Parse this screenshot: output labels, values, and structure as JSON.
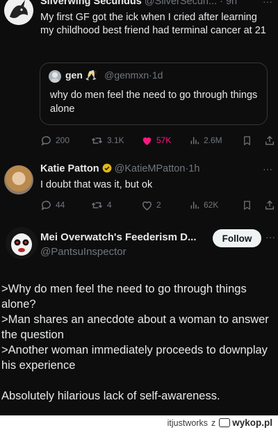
{
  "tweet1": {
    "display_name": "Silverwing Secundus",
    "handle": "@SilverSecun...",
    "time": "9h",
    "text": "My first GF got the ick when I cried after learning my childhood best friend had terminal cancer at 21",
    "quote": {
      "name": "gen",
      "emoji": "🥂",
      "handle": "@genmxn",
      "time": "1d",
      "text": "why do men feel the need to go through things alone"
    },
    "stats": {
      "replies": "200",
      "reposts": "3.1K",
      "likes": "57K",
      "views": "2.6M"
    }
  },
  "tweet2": {
    "display_name": "Katie Patton",
    "handle": "@KatieMPatton",
    "time": "1h",
    "text": "I doubt that was it, but ok",
    "stats": {
      "replies": "44",
      "reposts": "4",
      "likes": "2",
      "views": "62K"
    }
  },
  "tweet3": {
    "display_name": "Mei Overwatch's Feederism D...",
    "handle": "@PantsuInspector",
    "follow_label": "Follow",
    "lines": [
      ">Why do men feel the need to go through things alone?",
      ">Man shares an anecdote about a woman to answer the question",
      ">Another woman immediately proceeds to downplay his experience",
      "Absolutely hilarious lack of self-awareness."
    ]
  },
  "watermark": {
    "user": "itjustworks",
    "sep": "z",
    "site": "wykop.pl"
  },
  "colors": {
    "like_pink": "#f91880",
    "verified_gold": "#e2b719",
    "background": "#0d0d0e"
  }
}
